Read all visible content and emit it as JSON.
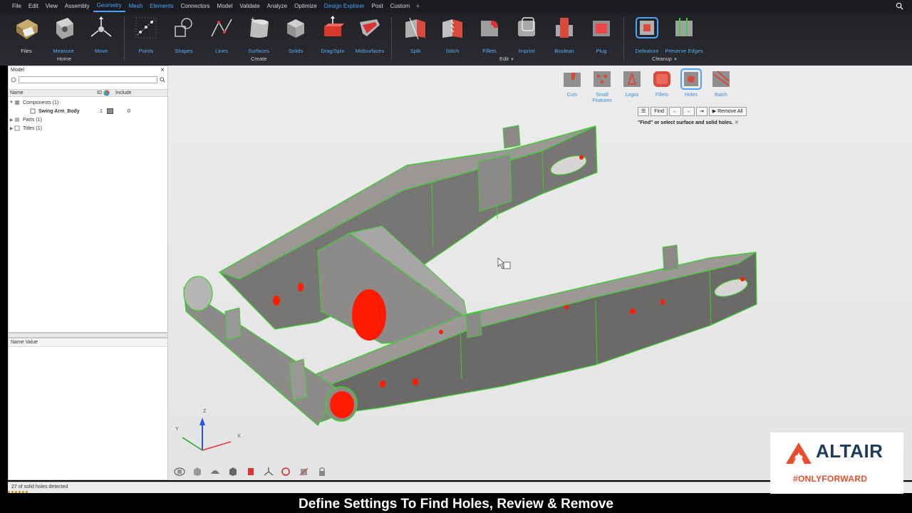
{
  "menubar": {
    "items": [
      "File",
      "Edit",
      "View",
      "Assembly",
      "Geometry",
      "Mesh",
      "Elements",
      "Connectors",
      "Model",
      "Validate",
      "Analyze",
      "Optimize",
      "Design Explorer",
      "Post",
      "Custom"
    ],
    "active": "Geometry"
  },
  "ribbon": {
    "tools": {
      "files": "Files",
      "measure": "Measure",
      "move": "Move",
      "points": "Points",
      "shapes": "Shapes",
      "lines": "Lines",
      "surfaces": "Surfaces",
      "solids": "Solids",
      "dragspin": "Drag/Spin",
      "midsurfaces": "Midsurfaces",
      "split": "Split",
      "stitch": "Stitch",
      "fillets": "Fillets",
      "imprint": "Imprint",
      "boolean": "Boolean",
      "plug": "Plug",
      "defeature": "Defeature",
      "preserve_edges": "Preserve Edges"
    },
    "groups": {
      "home": "Home",
      "create": "Create",
      "edit": "Edit",
      "cleanup": "Cleanup"
    }
  },
  "model_panel": {
    "title": "Model",
    "columns": {
      "name": "Name",
      "id": "ID",
      "include": "Include"
    },
    "tree": [
      {
        "label": "Components (1)"
      },
      {
        "label": "Swing Arm_Body",
        "id": "1",
        "include": "0"
      },
      {
        "label": "Parts (1)"
      },
      {
        "label": "Titles (1)"
      }
    ]
  },
  "prop_panel": {
    "header": "Name Value"
  },
  "defeature": {
    "tools": {
      "cuts": "Cuts",
      "small_features": "Small Features",
      "logos": "Logos",
      "fillets": "Fillets",
      "holes": "Holes",
      "batch": "Batch"
    },
    "buttons": {
      "find": "Find",
      "remove_all": "Remove All"
    },
    "message": "\"Find\" or select surface and solid holes."
  },
  "axes": {
    "x": "X",
    "y": "Y",
    "z": "Z"
  },
  "status": "27 of solid holes detected",
  "caption": "Define Settings To Find Holes, Review & Remove",
  "logo": {
    "word": "ALTAIR",
    "tagline": "#ONLYFORWARD"
  },
  "colors": {
    "accent": "#4aa3ff",
    "hole_red": "#ff1a00",
    "edge_green": "#39d12b",
    "part_gray": "#7d7b79",
    "brand_orange": "#e84e2d",
    "brand_navy": "#1e3c5a"
  }
}
